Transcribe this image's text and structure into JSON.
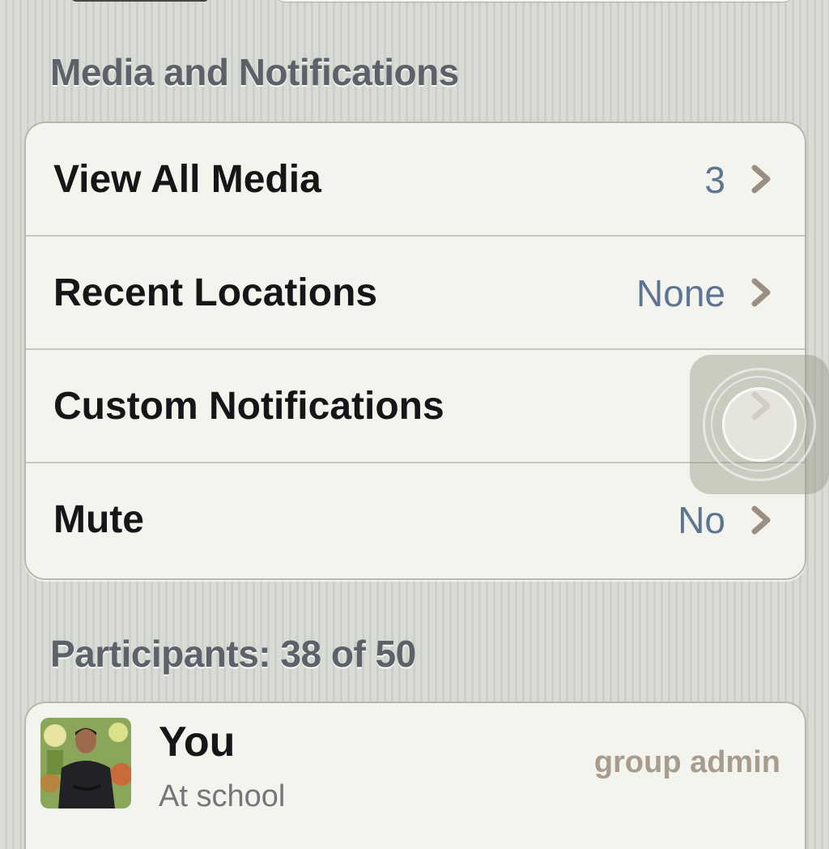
{
  "sections": {
    "media": {
      "header": "Media and Notifications",
      "rows": [
        {
          "label": "View All Media",
          "value": "3"
        },
        {
          "label": "Recent Locations",
          "value": "None"
        },
        {
          "label": "Custom Notifications",
          "value": ""
        },
        {
          "label": "Mute",
          "value": "No"
        }
      ]
    },
    "participants": {
      "header": "Participants: 38 of 50",
      "items": [
        {
          "name": "You",
          "status": "At school",
          "role": "group admin"
        }
      ]
    }
  },
  "icons": {
    "chevron": "chevron-right-icon",
    "assistive_touch": "assistive-touch-icon",
    "avatar": "avatar"
  },
  "colors": {
    "value_text": "#5d7593",
    "chevron": "#9a8f82",
    "role_text": "#a79c8e",
    "header_text": "#5d6169"
  }
}
